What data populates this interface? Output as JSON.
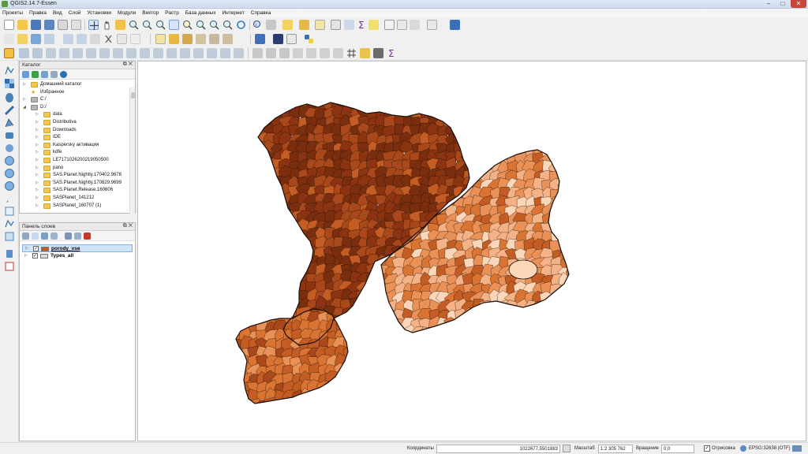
{
  "window": {
    "title": "QGIS2.14.7-Essen"
  },
  "menu": [
    "Проекты",
    "Правка",
    "Вид",
    "Слой",
    "Установки",
    "Модули",
    "Вектор",
    "Растр",
    "База данных",
    "Интернет",
    "Справка"
  ],
  "browser_panel": {
    "title": "Каталог",
    "items": [
      {
        "label": "Домашний каталог",
        "type": "folder",
        "level": 0
      },
      {
        "label": "Избранное",
        "type": "star",
        "level": 0
      },
      {
        "label": "C:/",
        "type": "drive",
        "level": 0
      },
      {
        "label": "D:/",
        "type": "drive",
        "level": 0
      },
      {
        "label": "data",
        "type": "folder",
        "level": 1
      },
      {
        "label": "Distributiva",
        "type": "folder",
        "level": 1
      },
      {
        "label": "Downloads",
        "type": "folder",
        "level": 1
      },
      {
        "label": "IDE",
        "type": "folder",
        "level": 1
      },
      {
        "label": "Kaspersky активация",
        "type": "folder",
        "level": 1
      },
      {
        "label": "kdfe",
        "type": "folder",
        "level": 1
      },
      {
        "label": "LE7171026200219050500",
        "type": "folder",
        "level": 1
      },
      {
        "label": "pano",
        "type": "folder",
        "level": 1
      },
      {
        "label": "SAS.Planet.Nightly.170402.9678",
        "type": "folder",
        "level": 1
      },
      {
        "label": "SAS.Planet.Nightly.170829.9699",
        "type": "folder",
        "level": 1
      },
      {
        "label": "SAS.Planet.Release.160606",
        "type": "folder",
        "level": 1
      },
      {
        "label": "SASPlanet_141212",
        "type": "folder",
        "level": 1
      },
      {
        "label": "SASPlanet_160707 (1)",
        "type": "folder",
        "level": 1
      }
    ]
  },
  "layers_panel": {
    "title": "Панель слоев",
    "layers": [
      {
        "name": "porody_vse",
        "checked": true,
        "selected": true
      },
      {
        "name": "Types_all",
        "checked": true,
        "selected": false
      }
    ]
  },
  "statusbar": {
    "coords_label": "Координаты",
    "coords_value": "1022677,5501883",
    "scale_label": "Масштаб",
    "scale_value": "1:2 305 762",
    "rotation_label": "Вращение",
    "rotation_value": "0,0",
    "render_label": "Отрисовка",
    "crs_label": "EPSG:32638 (OTF)"
  },
  "map": {
    "fill_colors": [
      "#7b2e0e",
      "#8c3411",
      "#a9481a",
      "#c45d23",
      "#d97433",
      "#ea9158",
      "#f4b286",
      "#fbd6b8"
    ],
    "stroke_color": "#1a0e08"
  }
}
